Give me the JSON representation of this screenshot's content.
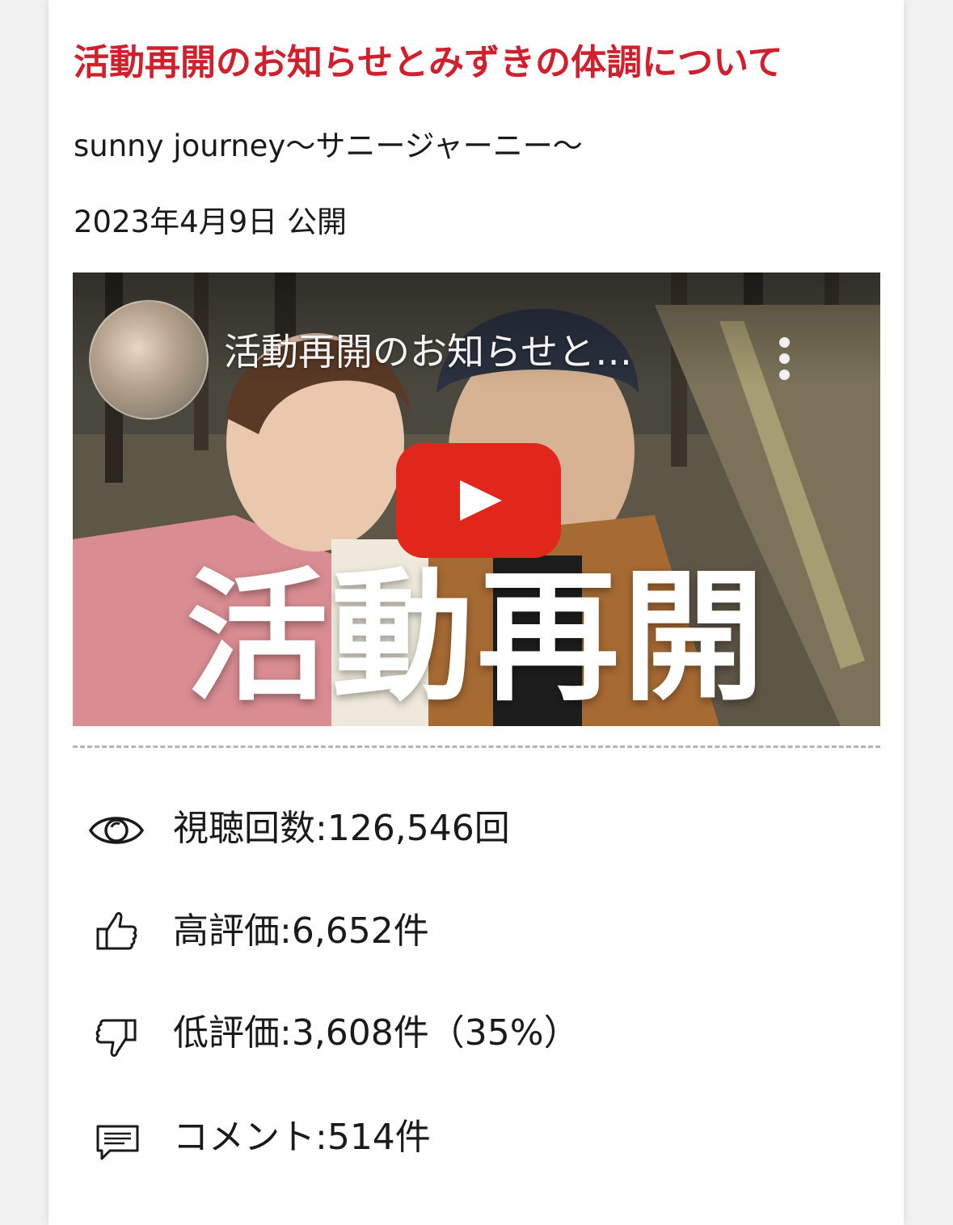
{
  "article": {
    "title": "活動再開のお知らせとみずきの体調について",
    "channel": "sunny journey〜サニージャーニー〜",
    "published": "2023年4月9日 公開"
  },
  "video": {
    "title": "活動再開のお知らせと…",
    "caption": "活動再開",
    "play_icon": "play-icon",
    "menu_icon": "more-vert-icon"
  },
  "stats": {
    "views": "視聴回数:126,546回",
    "likes": "高評価:6,652件",
    "dislikes": "低評価:3,608件（35%）",
    "comments": "コメント:514件"
  },
  "colors": {
    "title_red": "#d0202e",
    "play_red": "#e1261c"
  }
}
